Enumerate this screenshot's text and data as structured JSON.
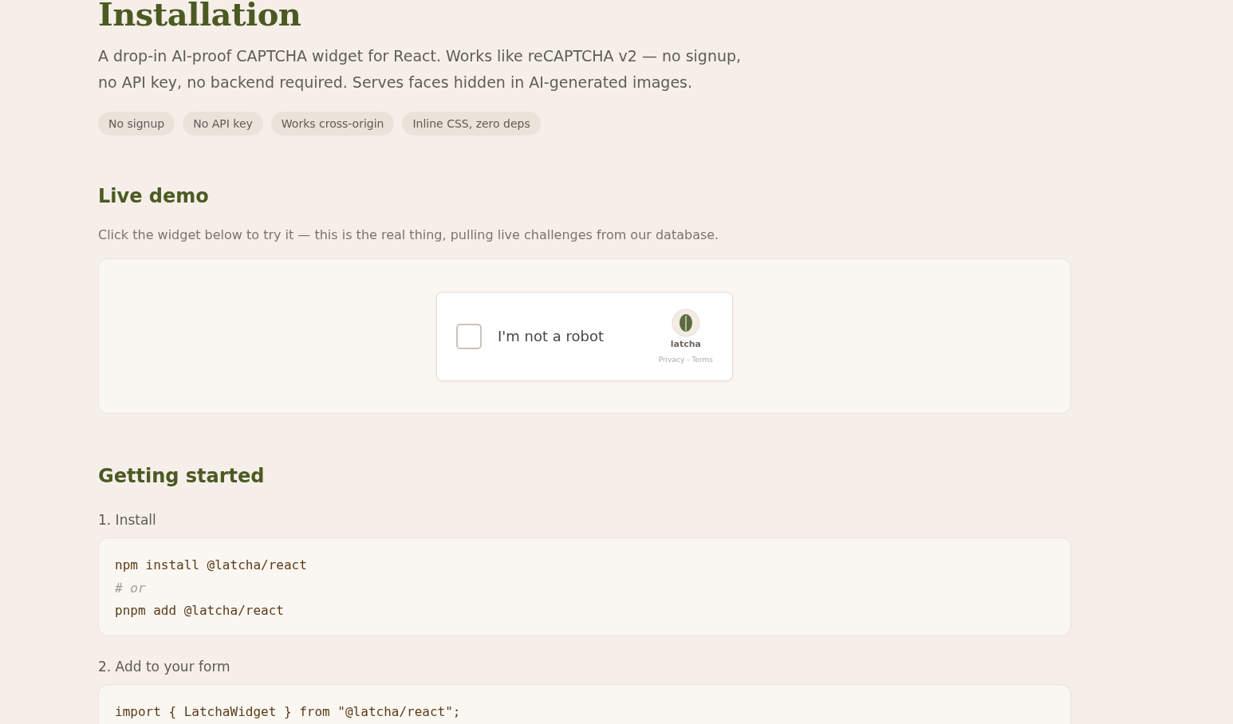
{
  "title": "Installation",
  "intro": "A drop-in AI-proof CAPTCHA widget for React. Works like reCAPTCHA v2 — no signup, no API key, no backend required. Serves faces hidden in AI-generated images.",
  "tags": [
    "No signup",
    "No API key",
    "Works cross-origin",
    "Inline CSS, zero deps"
  ],
  "demo": {
    "heading": "Live demo",
    "description": "Click the widget below to try it — this is the real thing, pulling live challenges from our database.",
    "widget": {
      "checked": false,
      "label": "I'm not a robot",
      "brand": "latcha",
      "privacy": "Privacy",
      "separator": "-",
      "terms": "Terms"
    }
  },
  "getting_started": {
    "heading": "Getting started",
    "steps": [
      {
        "title": "1. Install",
        "code": [
          {
            "kind": "command",
            "text": "npm install @latcha/react"
          },
          {
            "kind": "comment",
            "text": "# or"
          },
          {
            "kind": "command",
            "text": "pnpm add @latcha/react"
          }
        ]
      },
      {
        "title": "2. Add to your form",
        "code": [
          {
            "kind": "command",
            "text": "import { LatchaWidget } from \"@latcha/react\";"
          }
        ]
      }
    ]
  }
}
